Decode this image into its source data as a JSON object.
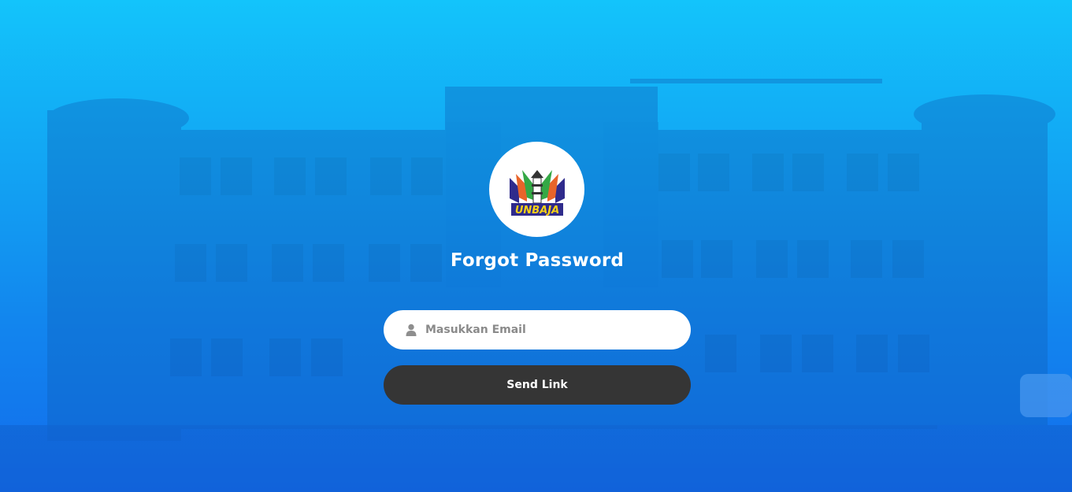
{
  "logo": {
    "text": "UNBAJA",
    "icon": "unbaja-logo-icon"
  },
  "form": {
    "title": "Forgot Password",
    "email_placeholder": "Masukkan Email",
    "email_value": "",
    "email_icon": "user-icon",
    "submit_label": "Send Link"
  },
  "colors": {
    "background_top": "#13c4fb",
    "background_bottom": "#136cec",
    "button": "#353535",
    "input_bg": "#ffffff"
  }
}
